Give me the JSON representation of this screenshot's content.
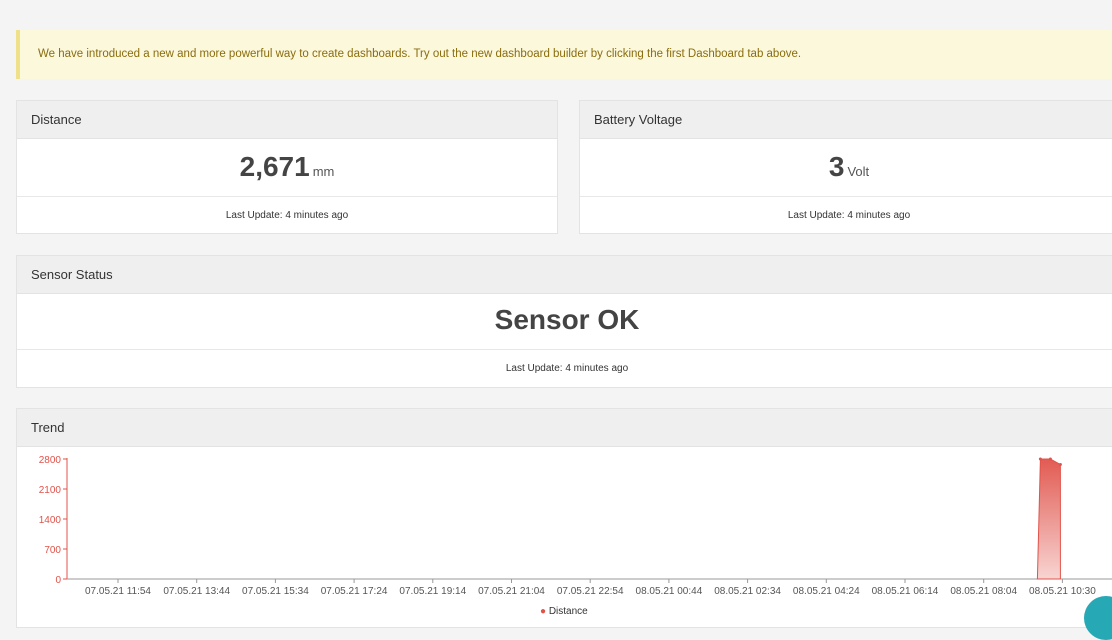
{
  "notice": {
    "text": "We have introduced a new and more powerful way to create dashboards. Try out the new dashboard builder by clicking the first Dashboard tab above."
  },
  "distance": {
    "title": "Distance",
    "value": "2,671",
    "unit": "mm",
    "last_update": "Last Update: 4 minutes ago"
  },
  "battery": {
    "title": "Battery Voltage",
    "value": "3",
    "unit": "Volt",
    "last_update": "Last Update: 4 minutes ago"
  },
  "sensor_status": {
    "title": "Sensor Status",
    "value": "Sensor OK",
    "last_update": "Last Update: 4 minutes ago"
  },
  "trend": {
    "title": "Trend",
    "legend": "Distance",
    "series_color": "#e0534a"
  },
  "chart_data": {
    "type": "area",
    "yticks": [
      0,
      700,
      1400,
      2100,
      2800
    ],
    "ylim": [
      0,
      2800
    ],
    "xticks": [
      "07.05.21 11:54",
      "07.05.21 13:44",
      "07.05.21 15:34",
      "07.05.21 17:24",
      "07.05.21 19:14",
      "07.05.21 21:04",
      "07.05.21 22:54",
      "08.05.21 00:44",
      "08.05.21 02:34",
      "08.05.21 04:24",
      "08.05.21 06:14",
      "08.05.21 08:04",
      "08.05.21 10:30"
    ],
    "series": [
      {
        "name": "Distance",
        "x": [
          "08.05.21 10:30",
          "08.05.21 10:35",
          "08.05.21 10:40"
        ],
        "values": [
          2800,
          2800,
          2671
        ]
      }
    ]
  }
}
